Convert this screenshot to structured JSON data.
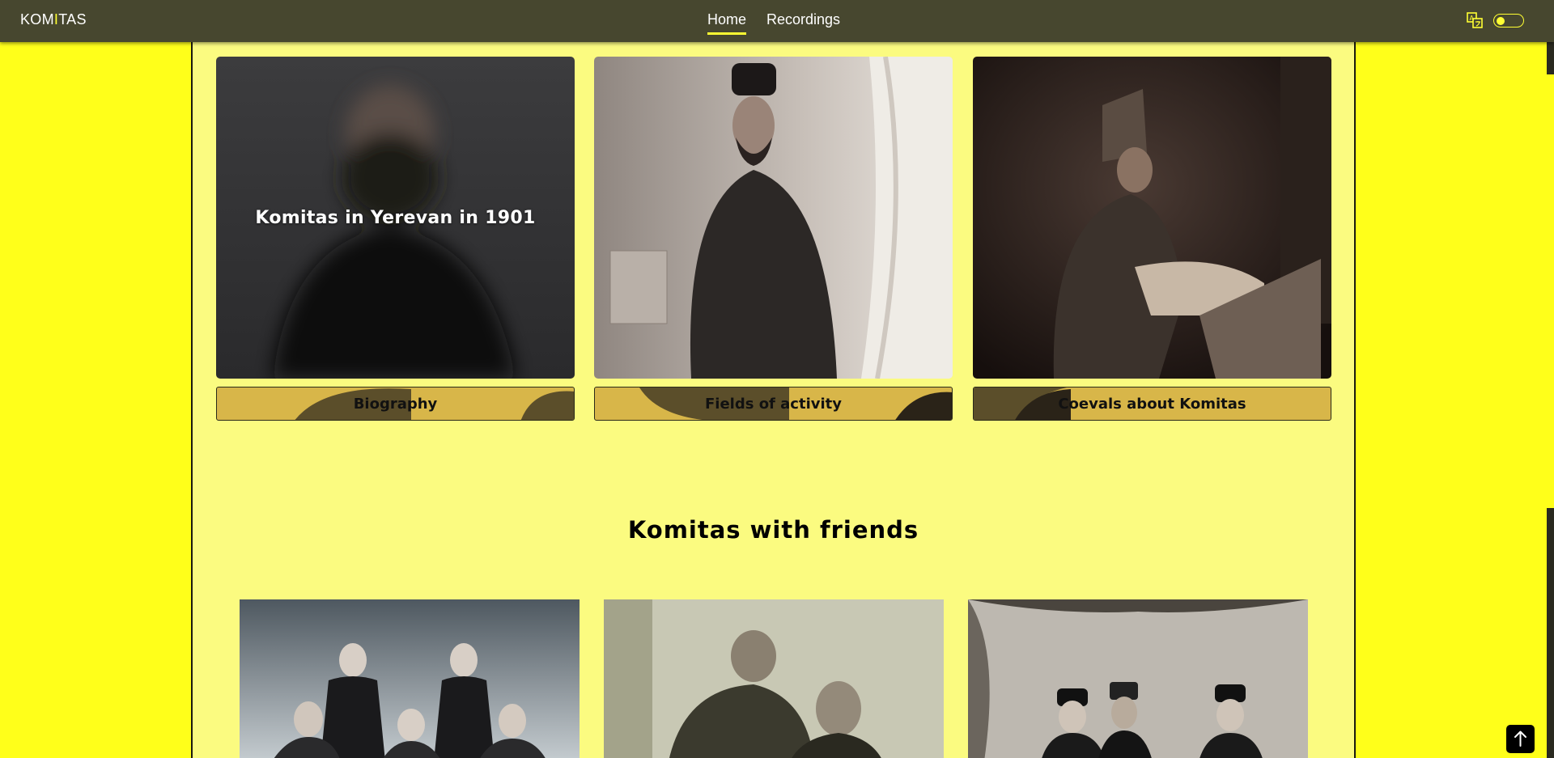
{
  "header": {
    "logo_main": "KOM",
    "logo_highlight": "I",
    "logo_rest": "TAS",
    "nav": [
      {
        "label": "Home",
        "active": true
      },
      {
        "label": "Recordings",
        "active": false
      }
    ],
    "icons": {
      "translate": "translate-icon",
      "theme_toggle": "theme-toggle"
    }
  },
  "cards": [
    {
      "overlay_text": "Komitas in Yerevan in 1901",
      "button_label": "Biography"
    },
    {
      "button_label": "Fields of activity"
    },
    {
      "button_label": "Coevals about Komitas"
    }
  ],
  "friends_section": {
    "title": "Komitas with friends"
  },
  "colors": {
    "page_bg": "#ffff1a",
    "content_bg": "#fbfb80",
    "nav_bg": "#47472f",
    "accent": "#ffff33",
    "button_bg": "#d8b649"
  },
  "icons": {
    "scroll_top": "arrow-up-icon"
  }
}
